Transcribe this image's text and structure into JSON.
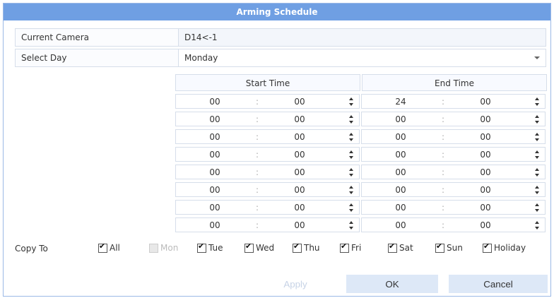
{
  "dialog": {
    "title": "Arming Schedule",
    "current_camera_label": "Current Camera",
    "current_camera_value": "D14<-1",
    "select_day_label": "Select Day",
    "select_day_value": "Monday"
  },
  "schedule": {
    "start_header": "Start Time",
    "end_header": "End Time",
    "rows": [
      {
        "start_h": "00",
        "start_m": "00",
        "end_h": "24",
        "end_m": "00"
      },
      {
        "start_h": "00",
        "start_m": "00",
        "end_h": "00",
        "end_m": "00"
      },
      {
        "start_h": "00",
        "start_m": "00",
        "end_h": "00",
        "end_m": "00"
      },
      {
        "start_h": "00",
        "start_m": "00",
        "end_h": "00",
        "end_m": "00"
      },
      {
        "start_h": "00",
        "start_m": "00",
        "end_h": "00",
        "end_m": "00"
      },
      {
        "start_h": "00",
        "start_m": "00",
        "end_h": "00",
        "end_m": "00"
      },
      {
        "start_h": "00",
        "start_m": "00",
        "end_h": "00",
        "end_m": "00"
      },
      {
        "start_h": "00",
        "start_m": "00",
        "end_h": "00",
        "end_m": "00"
      }
    ],
    "separator": ":"
  },
  "copy_to": {
    "label": "Copy To",
    "options": [
      {
        "label": "All",
        "checked": true,
        "disabled": false
      },
      {
        "label": "Mon",
        "checked": false,
        "disabled": true
      },
      {
        "label": "Tue",
        "checked": true,
        "disabled": false
      },
      {
        "label": "Wed",
        "checked": true,
        "disabled": false
      },
      {
        "label": "Thu",
        "checked": true,
        "disabled": false
      },
      {
        "label": "Fri",
        "checked": true,
        "disabled": false
      },
      {
        "label": "Sat",
        "checked": true,
        "disabled": false
      },
      {
        "label": "Sun",
        "checked": true,
        "disabled": false
      },
      {
        "label": "Holiday",
        "checked": true,
        "disabled": false
      }
    ]
  },
  "buttons": {
    "apply": "Apply",
    "ok": "OK",
    "cancel": "Cancel"
  }
}
